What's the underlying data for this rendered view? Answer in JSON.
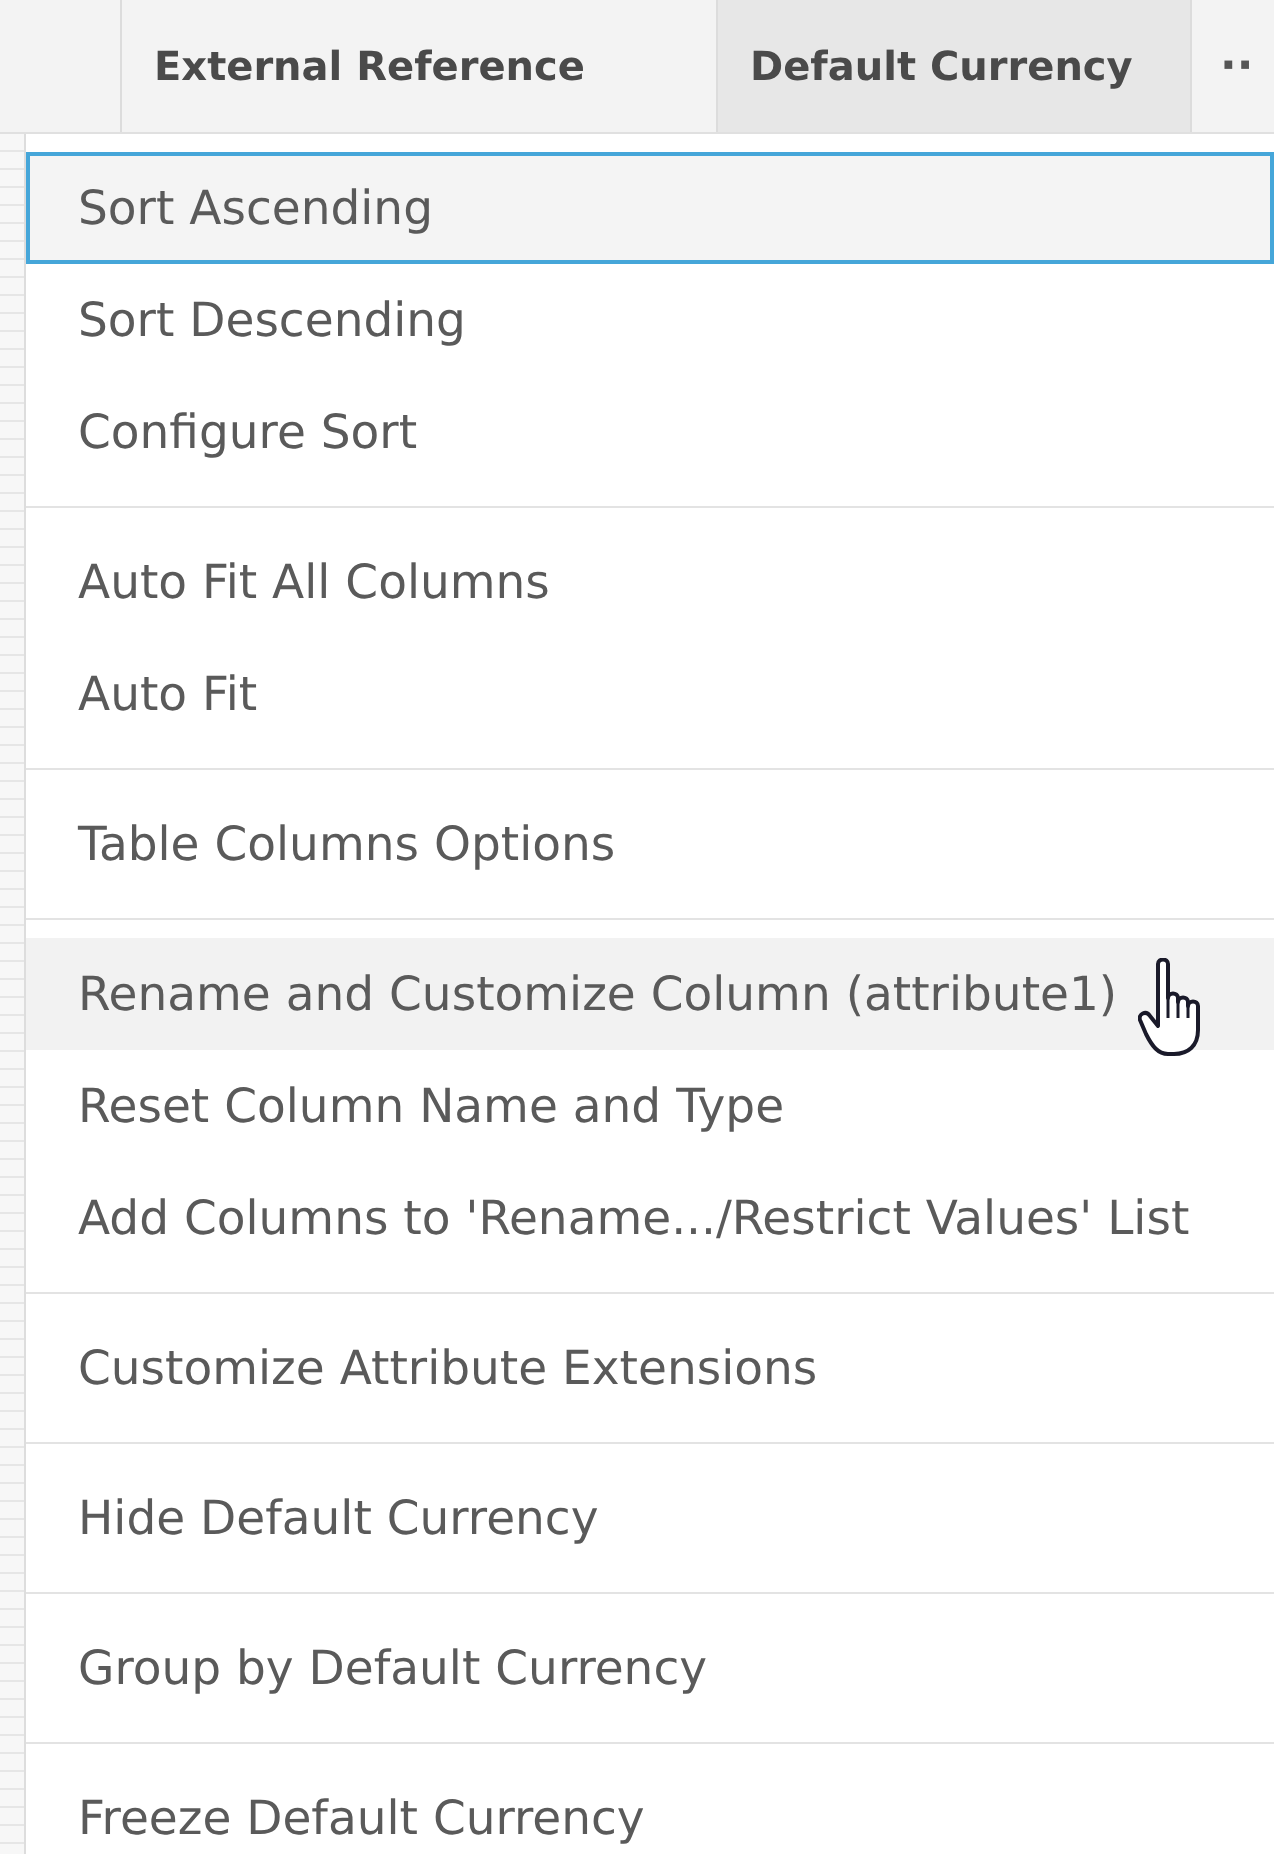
{
  "header": {
    "columns": [
      {
        "label": "External Reference",
        "hovered": false
      },
      {
        "label": "Default Currency",
        "hovered": true
      }
    ],
    "more": "··"
  },
  "menu": {
    "groups": [
      {
        "items": [
          {
            "label": "Sort Ascending",
            "focused": true,
            "hovered": false
          },
          {
            "label": "Sort Descending",
            "focused": false,
            "hovered": false
          },
          {
            "label": "Configure Sort",
            "focused": false,
            "hovered": false
          }
        ]
      },
      {
        "items": [
          {
            "label": "Auto Fit All Columns",
            "focused": false,
            "hovered": false
          },
          {
            "label": "Auto Fit",
            "focused": false,
            "hovered": false
          }
        ]
      },
      {
        "items": [
          {
            "label": "Table Columns Options",
            "focused": false,
            "hovered": false
          }
        ]
      },
      {
        "items": [
          {
            "label": "Rename and Customize Column (attribute1)",
            "focused": false,
            "hovered": true
          },
          {
            "label": "Reset Column Name and Type",
            "focused": false,
            "hovered": false
          },
          {
            "label": "Add Columns to 'Rename.../Restrict Values' List",
            "focused": false,
            "hovered": false
          }
        ]
      },
      {
        "items": [
          {
            "label": "Customize Attribute Extensions",
            "focused": false,
            "hovered": false
          }
        ]
      },
      {
        "items": [
          {
            "label": "Hide Default Currency",
            "focused": false,
            "hovered": false
          }
        ]
      },
      {
        "items": [
          {
            "label": "Group by Default Currency",
            "focused": false,
            "hovered": false
          }
        ]
      },
      {
        "items": [
          {
            "label": "Freeze Default Currency",
            "focused": false,
            "hovered": false
          }
        ]
      }
    ]
  }
}
